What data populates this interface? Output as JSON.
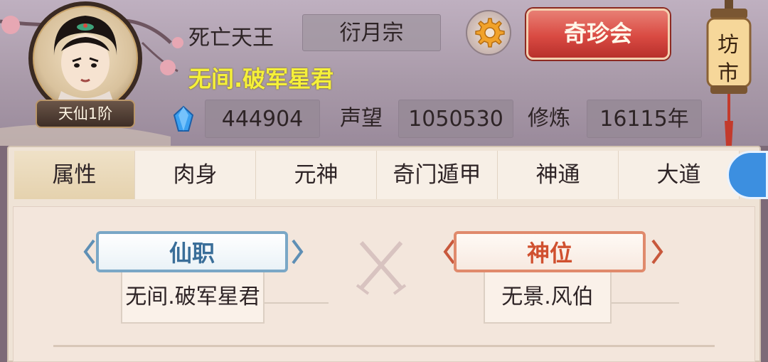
{
  "player": {
    "name": "死亡天王",
    "sect": "衍月宗",
    "title": "无间.破军星君",
    "rank": "天仙1阶"
  },
  "stats": {
    "gems": "444904",
    "prestige_label": "声望",
    "prestige": "1050530",
    "cultivation_label": "修炼",
    "cultivation": "16115年"
  },
  "buttons": {
    "treasure_fair": "奇珍会"
  },
  "market_lantern": {
    "line1": "坊",
    "line2": "市"
  },
  "tabs": [
    {
      "label": "属性",
      "active": true
    },
    {
      "label": "肉身",
      "active": false
    },
    {
      "label": "元神",
      "active": false
    },
    {
      "label": "奇门遁甲",
      "active": false
    },
    {
      "label": "神通",
      "active": false
    },
    {
      "label": "大道",
      "active": false
    }
  ],
  "positions": {
    "immortal_post": {
      "label": "仙职",
      "value": "无间.破军星君"
    },
    "divine_seat": {
      "label": "神位",
      "value": "无景.风伯"
    }
  },
  "icons": {
    "gear": "gear-icon",
    "gem": "gem-icon",
    "avatar": "avatar-portrait",
    "lantern": "lantern-icon",
    "crossed_swords": "crossed-swords-icon"
  },
  "colors": {
    "title_yellow": "#f5f03a",
    "button_red": "#d94a42",
    "post_blue": "#3a6e99",
    "seat_red": "#d0502f"
  }
}
